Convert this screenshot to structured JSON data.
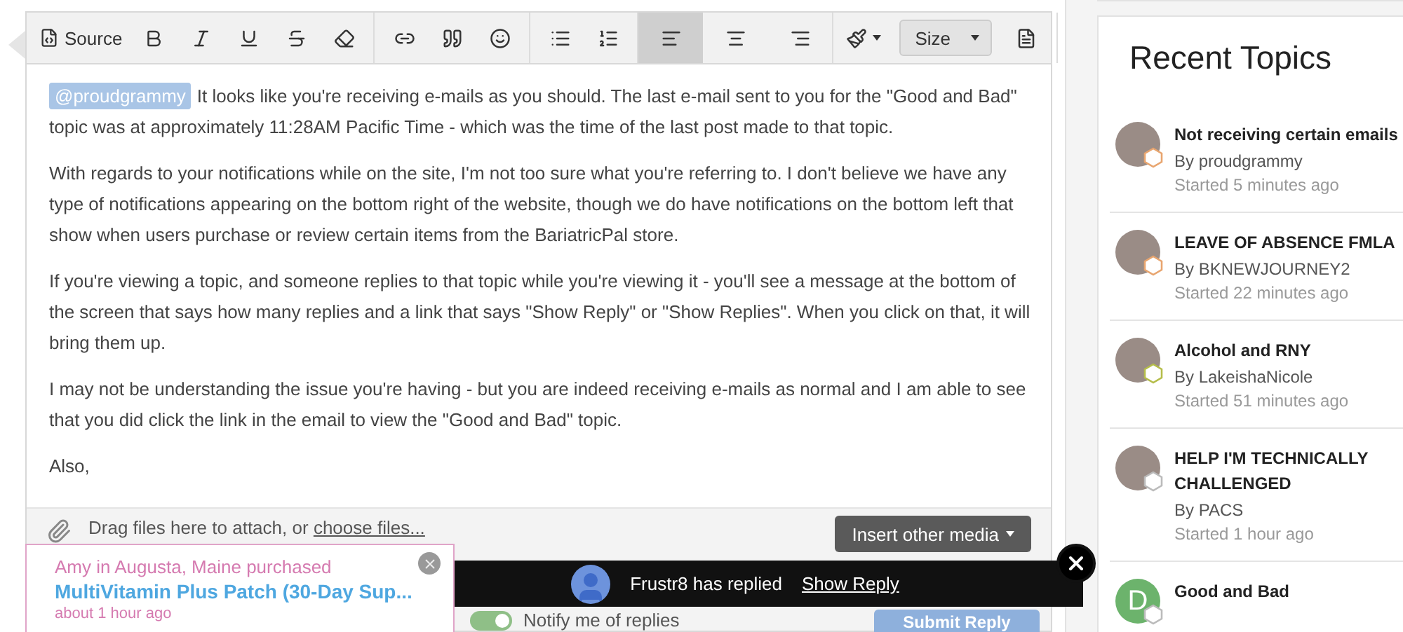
{
  "toolbar": {
    "source_label": "Source",
    "size_label": "Size",
    "align_buttons": [
      {
        "kind": "left",
        "selected": true
      },
      {
        "kind": "center",
        "selected": false
      },
      {
        "kind": "right",
        "selected": false
      }
    ]
  },
  "editor": {
    "paragraphs": [
      {
        "mention": "@proudgrammy",
        "text": "It looks like you're receiving e-mails as you should.  The last e-mail sent to you for the \"Good and Bad\" topic was at approximately 11:28AM Pacific Time - which was the time of the last post made to that topic."
      },
      {
        "text": "With regards to your notifications while on the site, I'm not too sure what you're referring to.  I don't believe we have any type of notifications appearing on the bottom right of the website, though we do have notifications on the bottom left that show when users purchase or review certain items from the BariatricPal store."
      },
      {
        "text": "If you're viewing a topic, and someone replies to that topic while you're viewing it - you'll see a message at the bottom of the screen that says how many replies and a link that says \"Show Reply\" or \"Show Replies\".  When you click on that, it will bring them up."
      },
      {
        "text": "I may not be understanding the issue you're having - but you are indeed receiving e-mails as normal and I am able to see that you did click the link in the email to view the \"Good and Bad\" topic."
      },
      {
        "text": "Also,"
      }
    ]
  },
  "attach": {
    "drag_text": "Drag files here to attach, or",
    "choose_link": "choose files...",
    "insert_button": "Insert other media"
  },
  "notify": {
    "label": "Notify me of replies",
    "checked": true
  },
  "submit_button": "Submit Reply",
  "purchase_popup": {
    "who": "Amy in Augusta, Maine purchased",
    "product": "MultiVitamin Plus Patch (30-Day Sup...",
    "time": "about 1 hour ago"
  },
  "reply_toast": {
    "message": "Frustr8 has replied",
    "link": "Show Reply"
  },
  "sidebar": {
    "title": "Recent Topics",
    "topics": [
      {
        "title": "Not receiving certain emails",
        "author": "By proudgrammy",
        "started": "Started 5 minutes ago",
        "color": "#e8a56f"
      },
      {
        "title": "LEAVE OF ABSENCE FMLA",
        "author": "By BKNEWJOURNEY2",
        "started": "Started 22 minutes ago",
        "color": "#e8a56f"
      },
      {
        "title": "Alcohol and RNY",
        "author": "By LakeishaNicole",
        "started": "Started 51 minutes ago",
        "color": "#b5bd4a"
      },
      {
        "title": "HELP I'M TECHNICALLY CHALLENGED",
        "author": "By PACS",
        "started": "Started 1 hour ago",
        "color": "#bbbbbb"
      },
      {
        "title": "Good and Bad",
        "avatar_letter": "D",
        "color": "#bbbbbb"
      }
    ]
  }
}
